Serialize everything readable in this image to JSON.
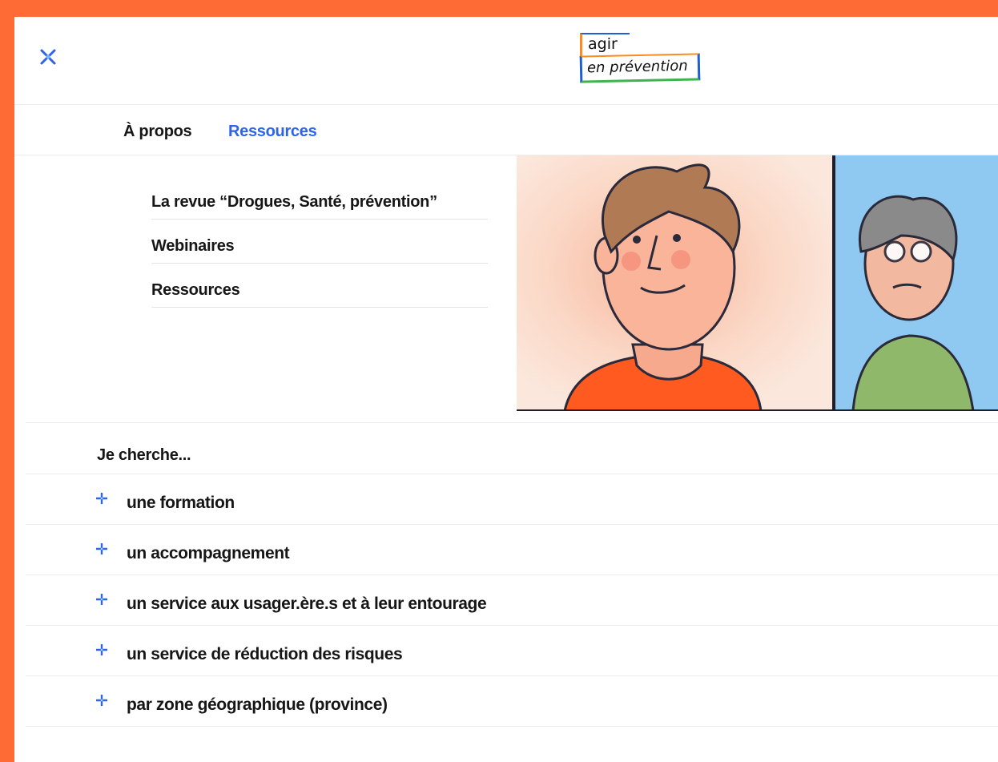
{
  "header": {
    "logo_line1": "agir",
    "logo_line2": "en prévention",
    "close_icon": "close-icon"
  },
  "nav": {
    "items": [
      {
        "label": "À propos",
        "active": false
      },
      {
        "label": "Ressources",
        "active": true
      }
    ]
  },
  "submenu": {
    "items": [
      {
        "label": "La revue “Drogues, Santé, prévention”"
      },
      {
        "label": "Webinaires"
      },
      {
        "label": "Ressources"
      }
    ]
  },
  "search": {
    "title": "Je cherche...",
    "items": [
      {
        "label": "une formation",
        "icon": "plus-icon"
      },
      {
        "label": "un accompagnement",
        "icon": "plus-icon"
      },
      {
        "label": "un service aux usager.ère.s et à leur entourage",
        "icon": "plus-icon"
      },
      {
        "label": "un service de réduction des risques",
        "icon": "plus-icon"
      },
      {
        "label": "par zone géographique (province)",
        "icon": "plus-icon"
      }
    ]
  },
  "colors": {
    "frame": "#ff6b35",
    "accent_blue": "#2e64e6",
    "text": "#161616"
  }
}
